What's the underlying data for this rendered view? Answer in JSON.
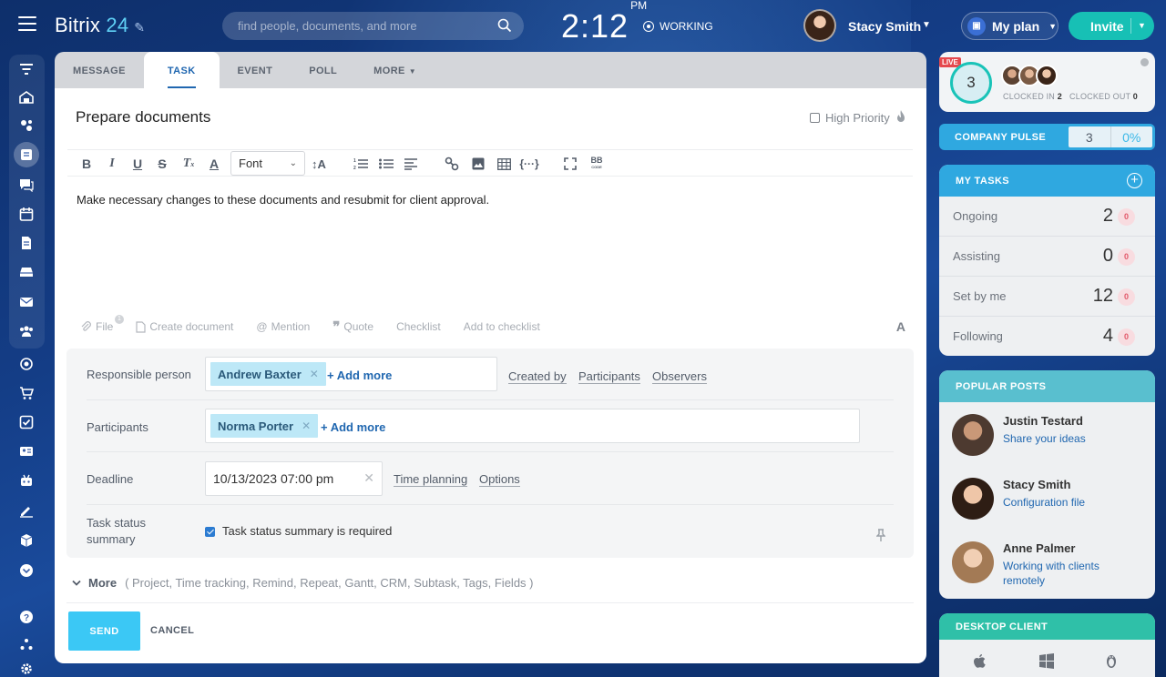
{
  "header": {
    "logo_word": "Bitrix",
    "logo_num": "24",
    "search_placeholder": "find people, documents, and more",
    "clock_time": "2:12",
    "clock_ampm": "PM",
    "status": "WORKING",
    "user_name": "Stacy Smith",
    "plan_label": "My plan",
    "invite_label": "Invite"
  },
  "composer": {
    "tabs": [
      {
        "label": "MESSAGE"
      },
      {
        "label": "TASK"
      },
      {
        "label": "EVENT"
      },
      {
        "label": "POLL"
      },
      {
        "label": "MORE"
      }
    ],
    "task_title": "Prepare documents",
    "high_priority_label": "High Priority",
    "high_priority_checked": false,
    "font_select": "Font",
    "body_text": "Make necessary changes to these documents and resubmit for client approval.",
    "attach": {
      "file": "File",
      "file_badge": "1",
      "create_document": "Create document",
      "mention": "Mention",
      "quote": "Quote",
      "checklist": "Checklist",
      "add_to_checklist": "Add to checklist",
      "font_toggle": "A"
    },
    "fields": {
      "responsible_label": "Responsible person",
      "responsible_tag": "Andrew Baxter",
      "add_more": "+ Add more",
      "created_by": "Created by",
      "participants_link": "Participants",
      "observers_link": "Observers",
      "participants_label": "Participants",
      "participants_tag": "Norma Porter",
      "deadline_label": "Deadline",
      "deadline_value": "10/13/2023 07:00 pm",
      "time_planning": "Time planning",
      "options": "Options",
      "summary_label": "Task status summary",
      "summary_check_label": "Task status summary is required",
      "summary_checked": true
    },
    "more_label": "More",
    "more_items": "( Project,  Time tracking,  Remind,  Repeat,  Gantt,  CRM,  Subtask,  Tags,  Fields )",
    "send_label": "SEND",
    "cancel_label": "CANCEL"
  },
  "sidebar": {
    "live_label": "LIVE",
    "clocked_count": "3",
    "clocked_in_label": "CLOCKED IN",
    "clocked_in_value": "2",
    "clocked_out_label": "CLOCKED OUT",
    "clocked_out_value": "0",
    "pulse_label": "COMPANY PULSE",
    "pulse_value": "3",
    "pulse_percent": "0%",
    "tasks_label": "MY TASKS",
    "tasks": [
      {
        "name": "Ongoing",
        "count": "2",
        "badge": "0"
      },
      {
        "name": "Assisting",
        "count": "0",
        "badge": "0"
      },
      {
        "name": "Set by me",
        "count": "12",
        "badge": "0"
      },
      {
        "name": "Following",
        "count": "4",
        "badge": "0"
      }
    ],
    "posts_label": "POPULAR POSTS",
    "posts": [
      {
        "author": "Justin Testard",
        "title": "Share your ideas"
      },
      {
        "author": "Stacy Smith",
        "title": "Configuration file"
      },
      {
        "author": "Anne Palmer",
        "title": "Working with clients remotely"
      }
    ],
    "desktop_label": "DESKTOP CLIENT"
  },
  "colors": {
    "accent": "#2067b0",
    "send": "#3bc8f5",
    "invite": "#17c0b5",
    "tasks_header": "#2fa8e0",
    "posts_header": "#59bfcf",
    "desktop_header": "#2fc0a8"
  }
}
